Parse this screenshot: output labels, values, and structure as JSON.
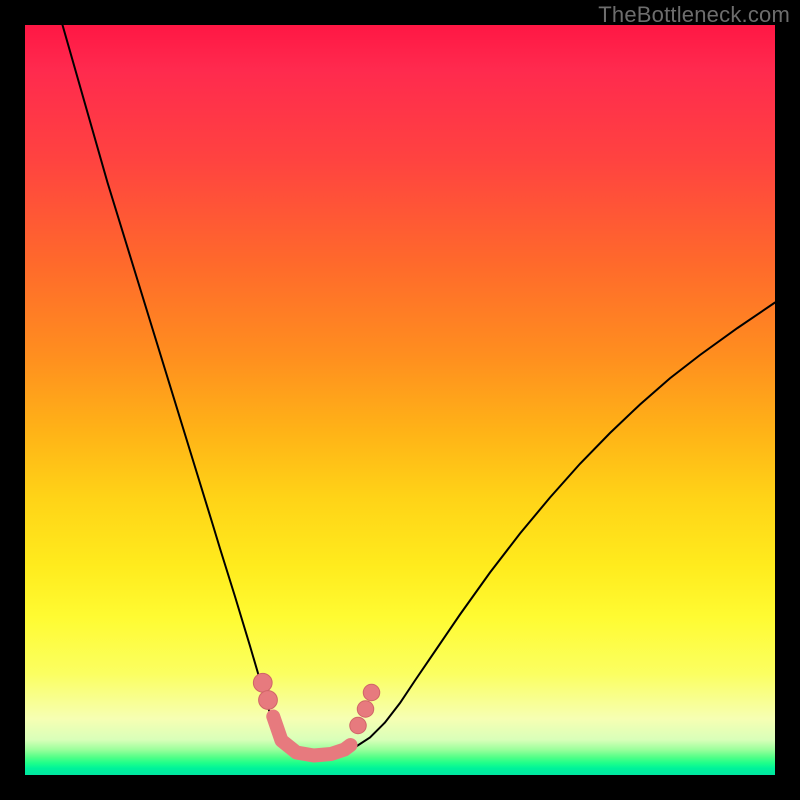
{
  "watermark": {
    "text": "TheBottleneck.com"
  },
  "colors": {
    "frame": "#000000",
    "curve": "#000000",
    "marker_fill": "#e77a7e",
    "marker_stroke": "#d06468"
  },
  "chart_data": {
    "type": "line",
    "title": "",
    "xlabel": "",
    "ylabel": "",
    "xlim": [
      0,
      100
    ],
    "ylim": [
      0,
      100
    ],
    "grid": false,
    "legend": false,
    "annotations": [],
    "series": [
      {
        "name": "left-branch",
        "x": [
          5,
          7,
          9,
          11,
          13,
          15,
          17,
          19,
          21,
          23,
          25,
          26,
          27,
          28,
          29,
          30,
          31,
          32,
          33,
          34,
          35
        ],
        "y": [
          100,
          93,
          86,
          79,
          72.5,
          66,
          59.5,
          53,
          46.5,
          40,
          33.5,
          30.2,
          27,
          23.8,
          20.5,
          17.2,
          13.8,
          10.3,
          7.2,
          4.7,
          3.4
        ]
      },
      {
        "name": "valley-floor",
        "x": [
          35,
          36,
          37,
          38,
          39,
          40,
          41,
          42,
          43,
          44
        ],
        "y": [
          3.4,
          2.9,
          2.6,
          2.45,
          2.4,
          2.45,
          2.6,
          2.85,
          3.2,
          3.7
        ]
      },
      {
        "name": "right-branch",
        "x": [
          44,
          46,
          48,
          50,
          52,
          55,
          58,
          62,
          66,
          70,
          74,
          78,
          82,
          86,
          90,
          95,
          100
        ],
        "y": [
          3.7,
          5.0,
          7.0,
          9.6,
          12.6,
          17.0,
          21.4,
          27.0,
          32.2,
          37.0,
          41.5,
          45.6,
          49.4,
          52.9,
          56.0,
          59.6,
          63.0
        ]
      }
    ],
    "markers": [
      {
        "name": "left-upper",
        "x": 31.7,
        "y": 12.3,
        "r": 1.25
      },
      {
        "name": "left-lower",
        "x": 32.4,
        "y": 10.0,
        "r": 1.25
      },
      {
        "name": "right-top",
        "x": 46.2,
        "y": 11.0,
        "r": 1.1
      },
      {
        "name": "right-mid",
        "x": 45.4,
        "y": 8.8,
        "r": 1.1
      },
      {
        "name": "right-bottom",
        "x": 44.4,
        "y": 6.6,
        "r": 1.1
      }
    ],
    "marker_capsule": {
      "points": [
        {
          "x": 33.1,
          "y": 7.8
        },
        {
          "x": 34.2,
          "y": 4.6
        },
        {
          "x": 36.2,
          "y": 3.0
        },
        {
          "x": 38.5,
          "y": 2.6
        },
        {
          "x": 40.8,
          "y": 2.8
        },
        {
          "x": 42.6,
          "y": 3.4
        },
        {
          "x": 43.4,
          "y": 4.0
        }
      ]
    }
  }
}
